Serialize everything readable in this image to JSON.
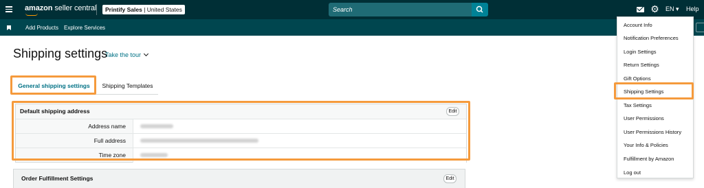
{
  "header": {
    "logo_text_bold": "amazon",
    "logo_text": " seller central",
    "account_brand": "Printify Sales",
    "account_region": " | United States",
    "search_placeholder": "Search",
    "language": "EN",
    "help": "Help"
  },
  "nav": {
    "items": [
      "Add Products",
      "Explore Services"
    ]
  },
  "page": {
    "title": "Shipping settings",
    "tour_link": "Take the tour"
  },
  "tabs": [
    {
      "label": "General shipping settings",
      "active": true
    },
    {
      "label": "Shipping Templates",
      "active": false
    }
  ],
  "default_address": {
    "heading": "Default shipping address",
    "edit_label": "Edit",
    "rows": [
      {
        "label": "Address name"
      },
      {
        "label": "Full address"
      },
      {
        "label": "Time zone"
      }
    ]
  },
  "order_fulfillment": {
    "heading": "Order Fulfillment Settings",
    "edit_label": "Edit"
  },
  "settings_menu": {
    "items": [
      "Account Info",
      "Notification Preferences",
      "Login Settings",
      "Return Settings",
      "Gift Options",
      "Shipping Settings",
      "Tax Settings",
      "User Permissions",
      "User Permissions History",
      "Your Info & Policies",
      "Fulfillment by Amazon",
      "Log out"
    ],
    "highlighted": "Shipping Settings"
  },
  "colors": {
    "header_bg": "#002f36",
    "nav_bg": "#00464f",
    "accent_teal": "#008296",
    "link": "#007185",
    "highlight_orange": "#f59a3c",
    "logo_smile": "#ff9900"
  }
}
